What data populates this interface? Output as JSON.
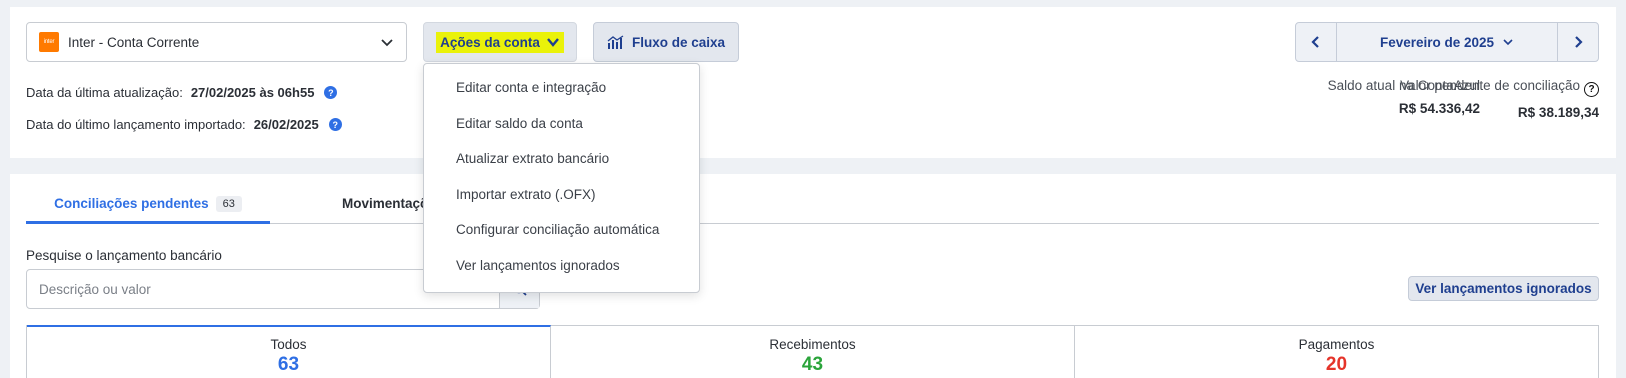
{
  "account": {
    "bank_logo_text": "inter",
    "name": "Inter - Conta Corrente"
  },
  "actions": {
    "label": "Ações da conta",
    "highlight_color": "#eaf20a"
  },
  "cashflow": {
    "label": "Fluxo de caixa"
  },
  "month_nav": {
    "label": "Fevereiro de 2025"
  },
  "info": {
    "last_update_label": "Data da última atualização:",
    "last_update_value": "27/02/2025 às 06h55",
    "last_import_label": "Data do último lançamento importado:",
    "last_import_value": "26/02/2025"
  },
  "balances": {
    "current_label": "Saldo atual na ContaAzul",
    "current_value": "R$ 54.336,42",
    "pending_label": "Valor pendente de conciliação",
    "pending_value": "R$ 38.189,34"
  },
  "tabs": {
    "pending_label": "Conciliações pendentes",
    "pending_count": "63",
    "movements_label": "Movimentações"
  },
  "search": {
    "label": "Pesquise o lançamento bancário",
    "placeholder": "Descrição ou valor"
  },
  "ignored_button": {
    "label": "Ver lançamentos ignorados"
  },
  "summary": [
    {
      "label": "Todos",
      "value": "63",
      "color": "#2f6fe4"
    },
    {
      "label": "Recebimentos",
      "value": "43",
      "color": "#2aa43a"
    },
    {
      "label": "Pagamentos",
      "value": "20",
      "color": "#e5342a"
    }
  ],
  "dropdown_items": [
    {
      "label": "Editar conta e integração"
    },
    {
      "label": "Editar saldo da conta"
    },
    {
      "label": "Atualizar extrato bancário"
    },
    {
      "label": "Importar extrato (.OFX)"
    },
    {
      "label": "Configurar conciliação automática"
    },
    {
      "label": "Ver lançamentos ignorados"
    }
  ],
  "colors": {
    "accent_blue": "#2f6fe4",
    "nav_blue": "#1f3f8f",
    "bank_orange": "#ff7a00"
  },
  "icons": [
    "chevron-down-icon",
    "chart-bars-icon",
    "chevron-left-icon",
    "chevron-right-icon",
    "help-icon",
    "search-icon"
  ]
}
